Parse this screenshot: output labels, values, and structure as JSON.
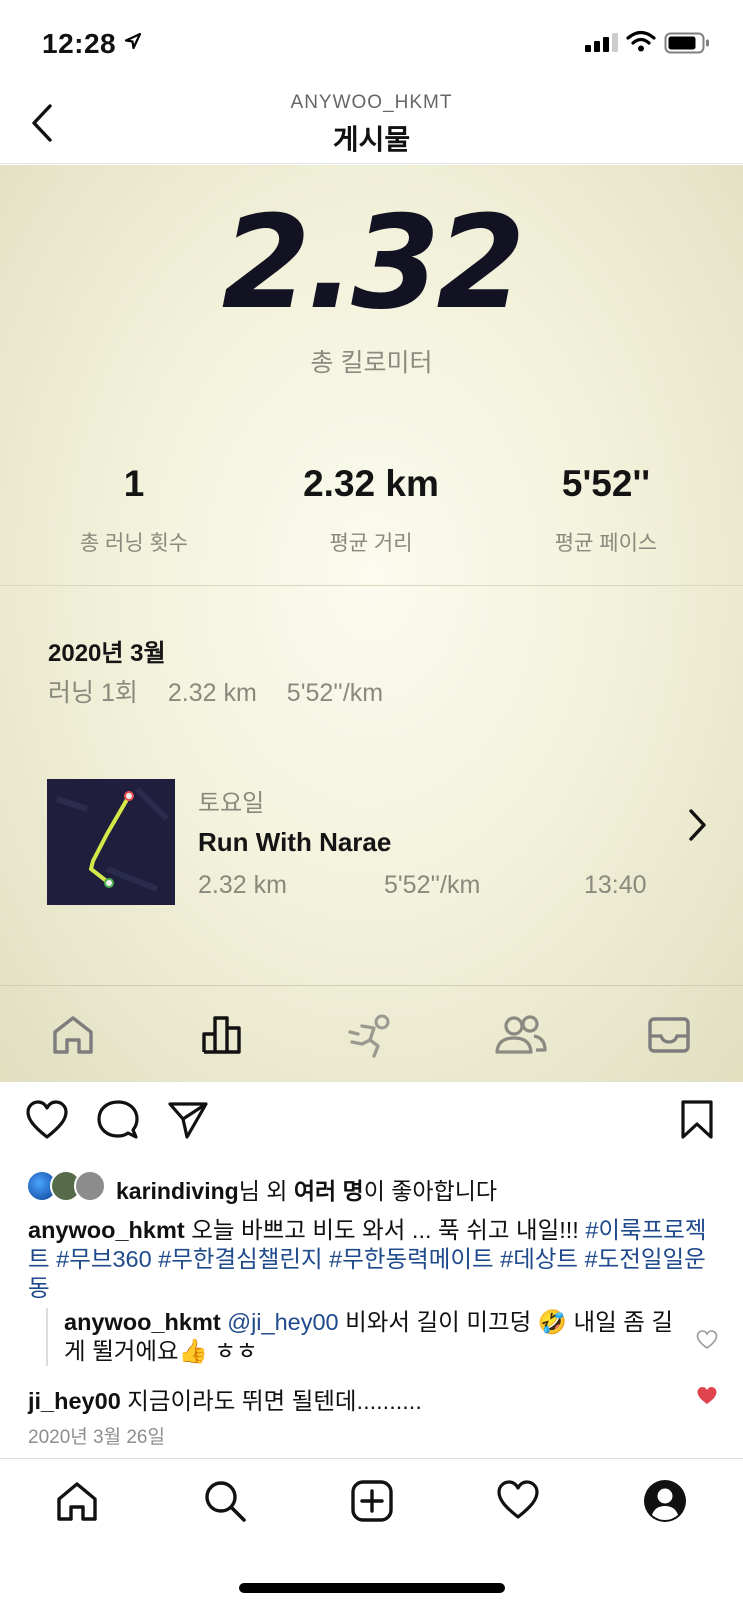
{
  "status": {
    "time": "12:28"
  },
  "nav": {
    "username": "ANYWOO_HKMT",
    "title": "게시물"
  },
  "post_image": {
    "total_km": "2.32",
    "total_km_label": "총 킬로미터",
    "stats": [
      {
        "value": "1",
        "label": "총 러닝 횟수"
      },
      {
        "value": "2.32 km",
        "label": "평균 거리"
      },
      {
        "value": "5'52''",
        "label": "평균 페이스"
      }
    ],
    "month": "2020년 3월",
    "month_runs": "러닝 1회",
    "month_distance": "2.32 km",
    "month_pace": "5'52''/km",
    "run": {
      "day": "토요일",
      "name": "Run With Narae",
      "distance": "2.32 km",
      "pace": "5'52''/km",
      "time": "13:40"
    },
    "tabs": [
      "home-icon",
      "chart-icon",
      "runner-icon",
      "people-icon",
      "inbox-icon"
    ]
  },
  "likes": {
    "user": "karindiving",
    "suffix1": "님 외 ",
    "bold2": "여러 명",
    "suffix2": "이 좋아합니다"
  },
  "caption": {
    "user": "anywoo_hkmt",
    "text": " 오늘 바쁘고 비도 와서 ... 푹 쉬고 내일!!! ",
    "tags": [
      "#이룩프로젝트",
      "#무브360",
      "#무한결심챌린지",
      "#무한동력메이트",
      "#데상트",
      "#도전일일운동"
    ]
  },
  "reply": {
    "user": "anywoo_hkmt",
    "mention": "@ji_hey00",
    "text1": " 비와서 길이 미끄덩 ",
    "emoji1": "🤣",
    "text2": " 내일 좀 길게 뛸거에요",
    "emoji2": "👍",
    "text3": " ㅎㅎ"
  },
  "comment2": {
    "user": "ji_hey00",
    "text": " 지금이라도 뛰면 될텐데.........."
  },
  "date": "2020년 3월 26일",
  "colors": {
    "accent_heart": "#e0454f",
    "hashtag": "#1f4a8c",
    "route": "#d4e84a"
  }
}
